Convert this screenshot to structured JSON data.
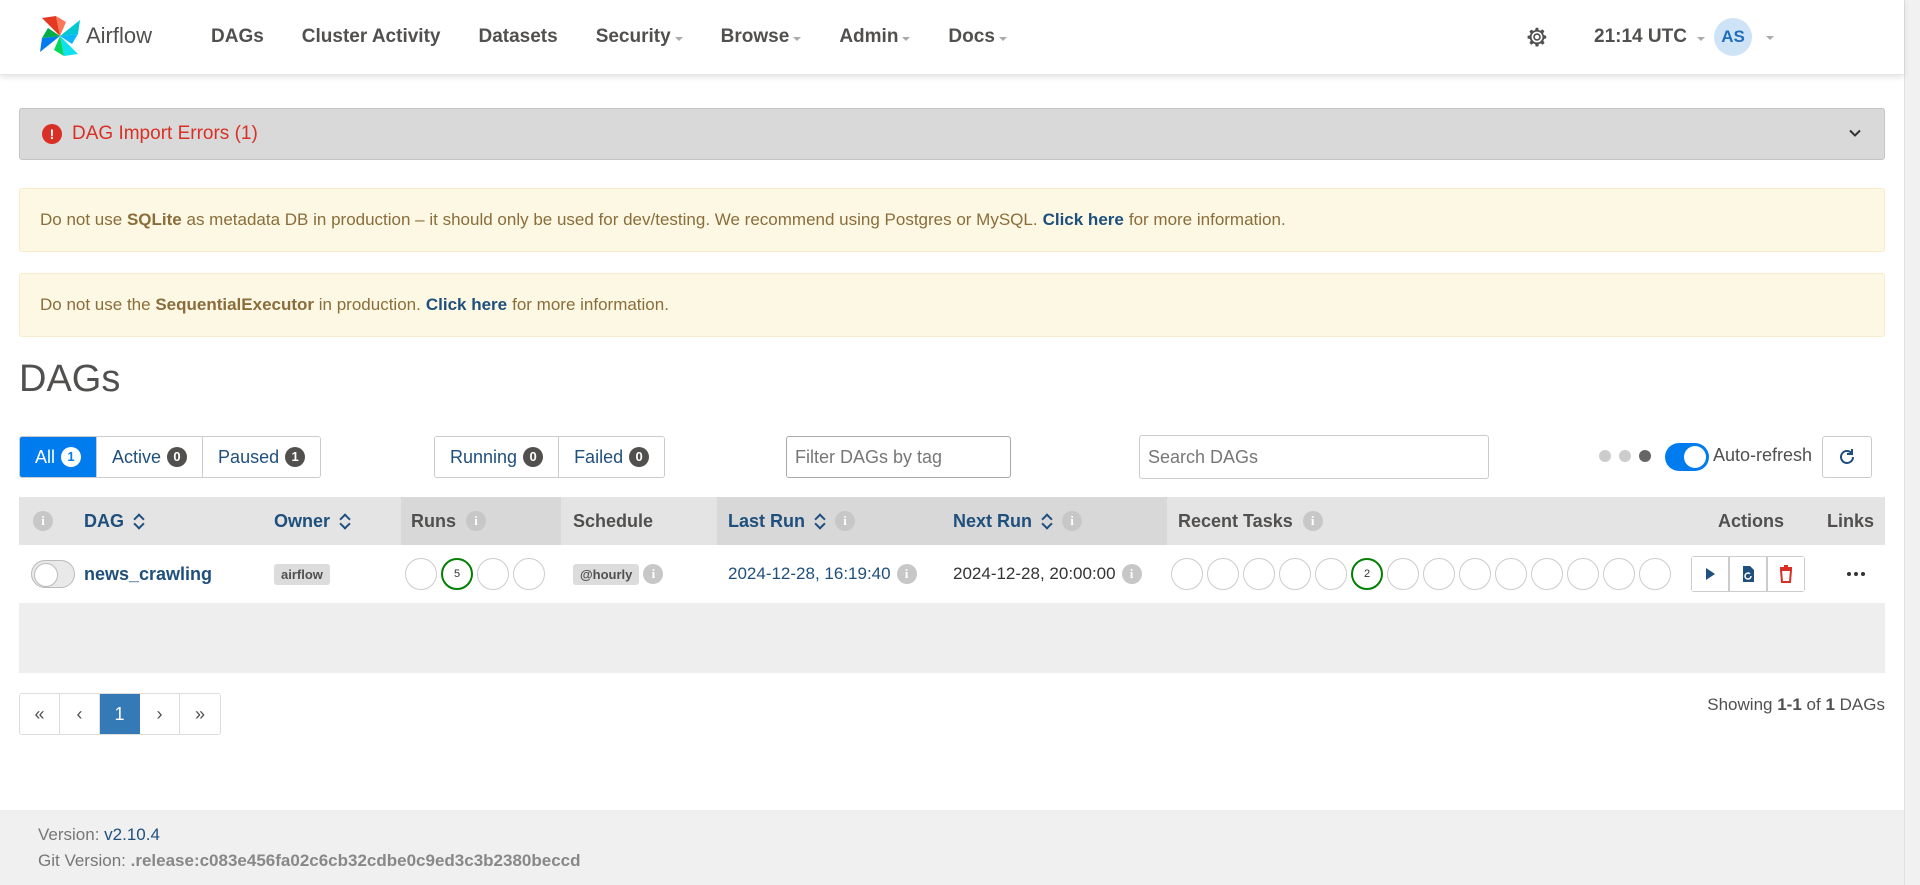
{
  "navbar": {
    "brand": "Airflow",
    "items": [
      {
        "label": "DAGs",
        "dropdown": false
      },
      {
        "label": "Cluster Activity",
        "dropdown": false
      },
      {
        "label": "Datasets",
        "dropdown": false
      },
      {
        "label": "Security",
        "dropdown": true
      },
      {
        "label": "Browse",
        "dropdown": true
      },
      {
        "label": "Admin",
        "dropdown": true
      },
      {
        "label": "Docs",
        "dropdown": true
      }
    ],
    "time": "21:14 UTC",
    "user_initials": "AS"
  },
  "import_errors": {
    "label": "DAG Import Errors (1)",
    "icon": "!"
  },
  "alerts": {
    "sqlite": {
      "pre": "Do not use",
      "bold": "SQLite",
      "mid": "as metadata DB in production – it should only be used for dev/testing. We recommend using Postgres or MySQL.",
      "link": "Click here",
      "post": "for more information."
    },
    "executor": {
      "pre": "Do not use the",
      "bold": "SequentialExecutor",
      "mid": "in production.",
      "link": "Click here",
      "post": "for more information."
    }
  },
  "page_title": "DAGs",
  "filters": {
    "status": [
      {
        "label": "All",
        "count": "1"
      },
      {
        "label": "Active",
        "count": "0"
      },
      {
        "label": "Paused",
        "count": "1"
      }
    ],
    "run_state": [
      {
        "label": "Running",
        "count": "0"
      },
      {
        "label": "Failed",
        "count": "0"
      }
    ],
    "tag_placeholder": "Filter DAGs by tag",
    "search_placeholder": "Search DAGs",
    "auto_refresh_label": "Auto-refresh"
  },
  "table": {
    "headers": {
      "dag": "DAG",
      "owner": "Owner",
      "runs": "Runs",
      "schedule": "Schedule",
      "last_run": "Last Run",
      "next_run": "Next Run",
      "recent_tasks": "Recent Tasks",
      "actions": "Actions",
      "links": "Links"
    },
    "info_glyph": "i",
    "rows": [
      {
        "dag_id": "news_crawling",
        "owner": "airflow",
        "runs": [
          "",
          "5",
          "",
          ""
        ],
        "schedule": "@hourly",
        "last_run": "2024-12-28, 16:19:40",
        "next_run": "2024-12-28, 20:00:00",
        "recent_tasks": [
          "",
          "",
          "",
          "",
          "",
          "2",
          "",
          "",
          "",
          "",
          "",
          "",
          "",
          "",
          ""
        ]
      }
    ]
  },
  "pagination": {
    "first": "«",
    "prev": "‹",
    "page": "1",
    "next": "›",
    "last": "»"
  },
  "showing": {
    "pre": "Showing",
    "range": "1-1",
    "of": "of",
    "total": "1",
    "post": "DAGs"
  },
  "footer": {
    "version_label": "Version:",
    "version": "v2.10.4",
    "git_label": "Git Version:",
    "git": ".release:c083e456fa02c6cb32cdbe0c9ed3c3b2380beccd"
  },
  "colors": {
    "primary": "#017cee",
    "link": "#1f4f7c",
    "error": "#d93025",
    "success": "#008000",
    "warning_bg": "#fcf8e3",
    "warning_text": "#8a6d3b"
  }
}
